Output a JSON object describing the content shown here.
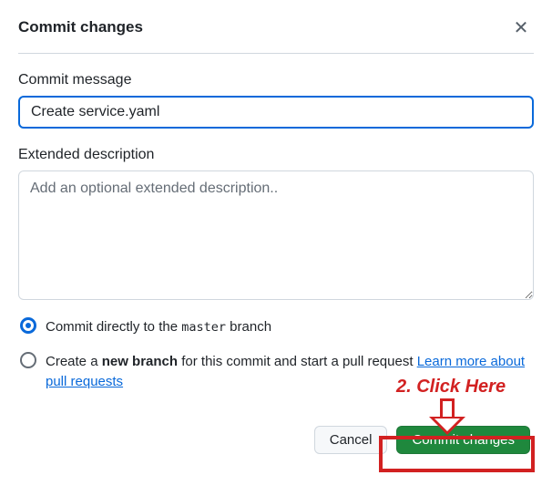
{
  "dialog": {
    "title": "Commit changes"
  },
  "fields": {
    "commit_message_label": "Commit message",
    "commit_message_value": "Create service.yaml",
    "extended_desc_label": "Extended description",
    "extended_desc_placeholder": "Add an optional extended description.."
  },
  "options": {
    "direct_prefix": "Commit directly to the ",
    "direct_branch": "master",
    "direct_suffix": " branch",
    "newbranch_prefix": "Create a ",
    "newbranch_bold": "new branch",
    "newbranch_suffix": " for this commit and start a pull request ",
    "learn_more": "Learn more about pull requests"
  },
  "buttons": {
    "cancel": "Cancel",
    "commit": "Commit changes"
  },
  "annotation": {
    "text": "2. Click Here"
  }
}
